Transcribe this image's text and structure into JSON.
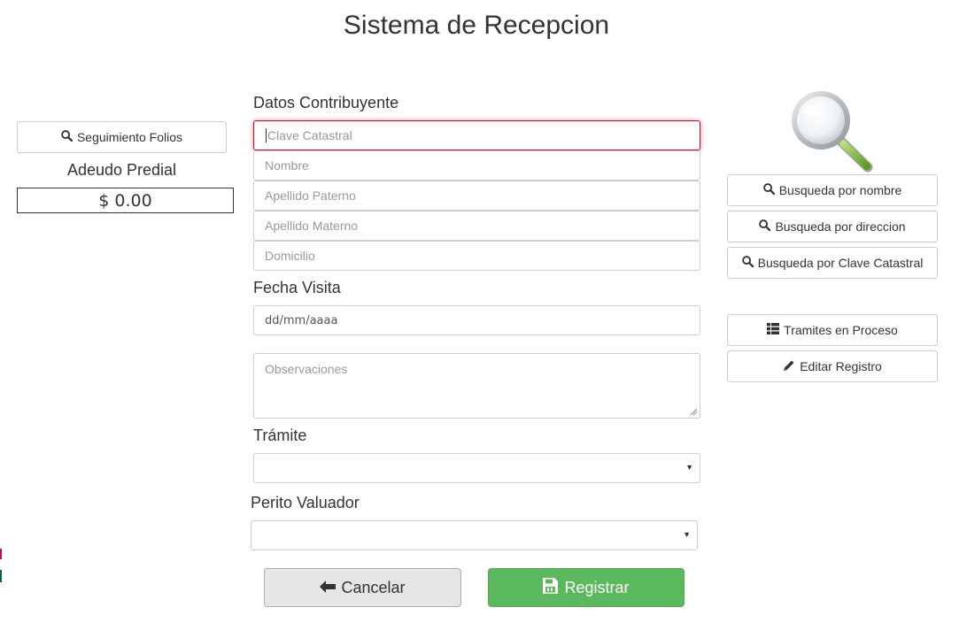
{
  "page": {
    "title": "Sistema de Recepcion"
  },
  "left": {
    "seguimiento_label": "Seguimiento Folios",
    "adeudo_label": "Adeudo Predial",
    "adeudo_value": "$ 0.00"
  },
  "form": {
    "section_contribuyente": "Datos Contribuyente",
    "clave_placeholder": "Clave Catastral",
    "nombre_placeholder": "Nombre",
    "apellido_paterno_placeholder": "Apellido Paterno",
    "apellido_materno_placeholder": "Apellido Materno",
    "domicilio_placeholder": "Domicilio",
    "fecha_label": "Fecha Visita",
    "fecha_value": "dd/mm/aaaa",
    "observaciones_placeholder": "Observaciones",
    "tramite_label": "Trámite",
    "tramite_value": "",
    "perito_label": "Perito Valuador",
    "perito_value": ""
  },
  "right": {
    "busqueda_nombre": "Busqueda por nombre",
    "busqueda_direccion": "Busqueda por direccion",
    "busqueda_clave": "Busqueda por Clave Catastral",
    "tramites_proceso": "Tramites en Proceso",
    "editar_registro": "Editar Registro"
  },
  "actions": {
    "cancel_label": "Cancelar",
    "register_label": "Registrar"
  },
  "icons": {
    "search": "search-icon",
    "magnifier": "magnifier-illustration",
    "list": "list-icon",
    "pencil": "pencil-icon",
    "arrow_left": "arrow-left-icon",
    "save": "save-icon",
    "chevron": "caret-down-icon"
  },
  "colors": {
    "primary_success": "#5cb85c",
    "focus_border": "#e0001b",
    "text": "#333333",
    "placeholder": "#999999"
  }
}
